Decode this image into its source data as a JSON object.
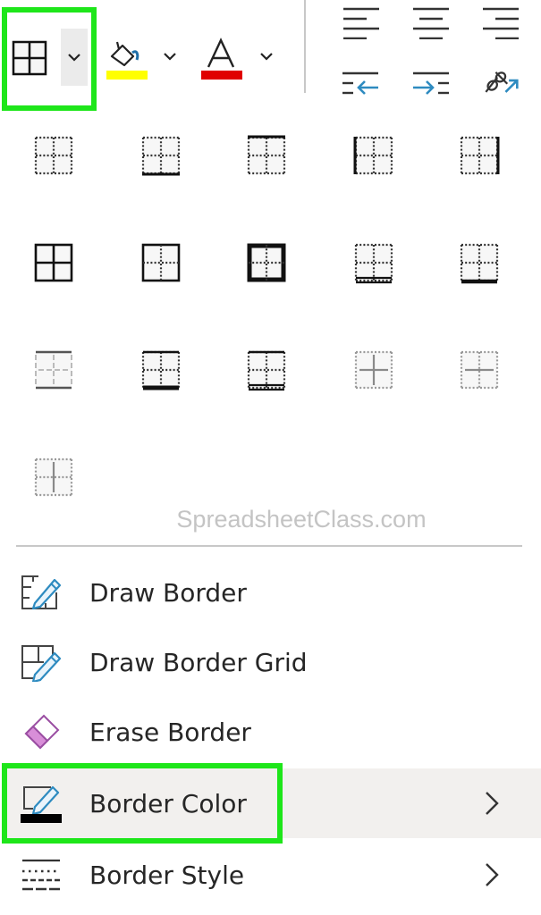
{
  "toolbar": {
    "borders_button": "Borders",
    "fill_color_button": "Fill Color",
    "font_color_button": "Font Color",
    "fill_color": "#ffff00",
    "font_color": "#e00000",
    "accent_blue": "#2e8bc0"
  },
  "border_presets": [
    {
      "name": "No Border"
    },
    {
      "name": "Bottom Border"
    },
    {
      "name": "Top Border"
    },
    {
      "name": "Left Border"
    },
    {
      "name": "Right Border"
    },
    {
      "name": "All Borders"
    },
    {
      "name": "Outside Borders"
    },
    {
      "name": "Thick Outside Borders"
    },
    {
      "name": "Bottom Double Border"
    },
    {
      "name": "Thick Bottom Border"
    },
    {
      "name": "Top and Bottom Border"
    },
    {
      "name": "Top and Thick Bottom Border"
    },
    {
      "name": "Top and Double Bottom Border"
    },
    {
      "name": "Inside Borders"
    },
    {
      "name": "Inside Horizontal Border"
    },
    {
      "name": "Inside Vertical Border"
    }
  ],
  "watermark": "SpreadsheetClass.com",
  "menu": {
    "items": [
      {
        "label": "Draw Border",
        "has_submenu": false
      },
      {
        "label": "Draw Border Grid",
        "has_submenu": false
      },
      {
        "label": "Erase Border",
        "has_submenu": false
      },
      {
        "label": "Border Color",
        "has_submenu": true
      },
      {
        "label": "Border Style",
        "has_submenu": true
      }
    ]
  },
  "highlight_color": "#1ee61a",
  "eraser_color": "#d88ed8"
}
